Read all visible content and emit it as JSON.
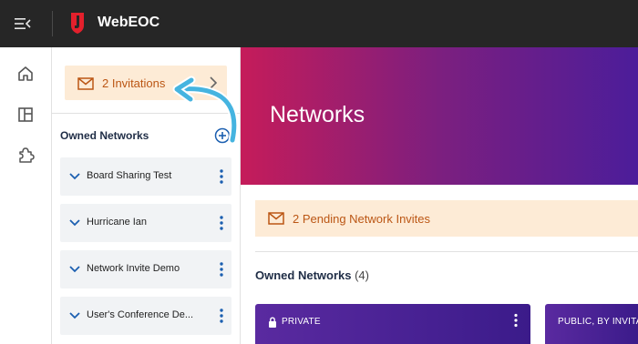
{
  "header": {
    "title": "WebEOC",
    "logo_icon": "webeoc-logo-icon",
    "menu_icon": "menu-collapse-icon"
  },
  "rail": {
    "items": [
      {
        "icon": "home-icon"
      },
      {
        "icon": "boards-icon"
      },
      {
        "icon": "puzzle-icon"
      }
    ]
  },
  "sidebar": {
    "invitations_label": "2 Invitations",
    "section_title": "Owned Networks",
    "networks": [
      {
        "name": "Board Sharing Test"
      },
      {
        "name": "Hurricane Ian"
      },
      {
        "name": "Network Invite Demo"
      },
      {
        "name": "User's Conference De..."
      }
    ]
  },
  "main": {
    "hero_title": "Networks",
    "pending_label": "2 Pending Network Invites",
    "section_title": "Owned Networks",
    "section_count": "(4)",
    "cards": [
      {
        "tag": "PRIVATE"
      },
      {
        "tag": "PUBLIC, BY INVITATI"
      }
    ]
  },
  "colors": {
    "accent_orange": "#bb5614",
    "invite_bg": "#fdebd6",
    "topbar": "#262626",
    "annotation_arrow": "#45b4e0"
  }
}
